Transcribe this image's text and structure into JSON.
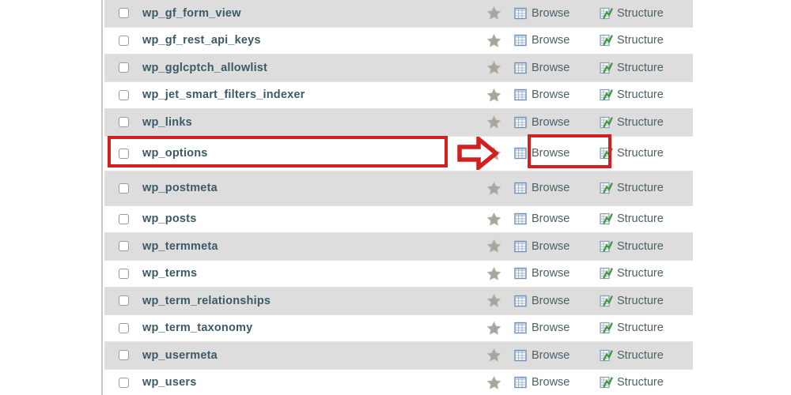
{
  "app": {
    "context": "phpmyadmin-database-tables-list",
    "colors": {
      "annotation_red": "#d21f1f",
      "row_alt_bg": "#dddddd",
      "row_bg": "#ffffff",
      "table_name_text": "#3c5a66",
      "action_link_text": "#4c6168",
      "browse_icon_blue": "#6f8fb5",
      "structure_icon_green": "#3f9a3f",
      "star_grey": "#a9a59c"
    }
  },
  "actions": {
    "browse_label": "Browse",
    "structure_label": "Structure",
    "browse_icon": "table-grid-icon",
    "structure_icon": "table-structure-icon",
    "favorite_icon": "star-icon",
    "select_icon": "checkbox-icon"
  },
  "annotations": {
    "row_highlight_target": "wp_options",
    "action_highlight_target": "Browse",
    "arrow_icon": "right-arrow-icon",
    "arrow_direction": "right"
  },
  "tables": [
    {
      "name": "wp_gf_form_view",
      "shaded": true,
      "tall": false
    },
    {
      "name": "wp_gf_rest_api_keys",
      "shaded": false,
      "tall": false
    },
    {
      "name": "wp_gglcptch_allowlist",
      "shaded": true,
      "tall": false
    },
    {
      "name": "wp_jet_smart_filters_indexer",
      "shaded": false,
      "tall": false
    },
    {
      "name": "wp_links",
      "shaded": true,
      "tall": false
    },
    {
      "name": "wp_options",
      "shaded": false,
      "tall": true
    },
    {
      "name": "wp_postmeta",
      "shaded": true,
      "tall": true
    },
    {
      "name": "wp_posts",
      "shaded": false,
      "tall": false
    },
    {
      "name": "wp_termmeta",
      "shaded": true,
      "tall": false
    },
    {
      "name": "wp_terms",
      "shaded": false,
      "tall": false
    },
    {
      "name": "wp_term_relationships",
      "shaded": true,
      "tall": false
    },
    {
      "name": "wp_term_taxonomy",
      "shaded": false,
      "tall": false
    },
    {
      "name": "wp_usermeta",
      "shaded": true,
      "tall": false
    },
    {
      "name": "wp_users",
      "shaded": false,
      "tall": false
    }
  ]
}
